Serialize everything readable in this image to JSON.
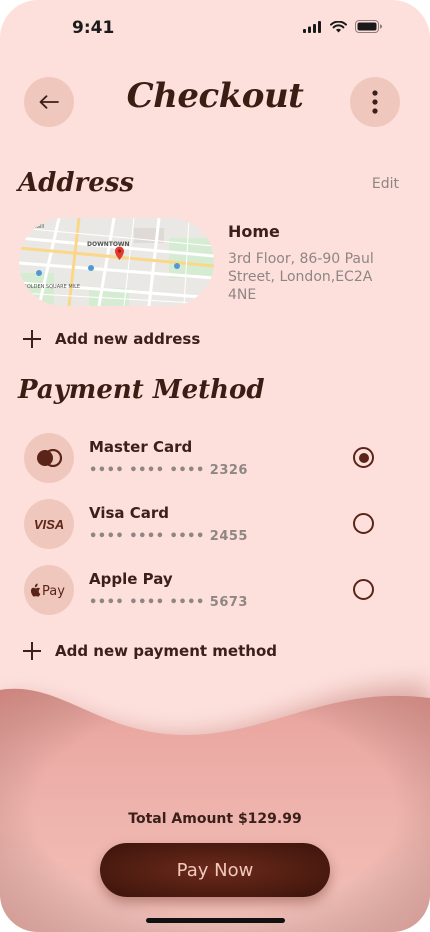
{
  "status_bar": {
    "time": "9:41"
  },
  "header": {
    "title": "Checkout"
  },
  "address": {
    "section_title": "Address",
    "edit_label": "Edit",
    "name": "Home",
    "detail": "3rd Floor, 86-90 Paul Street, London,EC2A 4NE",
    "add_label": "Add new address",
    "map_labels": [
      "DOWNTOWN",
      "GOLDEN SQUARE MILE",
      "McGill"
    ]
  },
  "payment": {
    "section_title": "Payment Method",
    "methods": [
      {
        "name": "Master Card",
        "number": "•••• •••• •••• 2326",
        "selected": true,
        "icon": "mastercard-icon"
      },
      {
        "name": "Visa Card",
        "number": "•••• •••• •••• 2455",
        "selected": false,
        "icon": "visa-icon"
      },
      {
        "name": "Apple Pay",
        "number": "•••• •••• •••• 5673",
        "selected": false,
        "icon": "apple-pay-icon"
      }
    ],
    "add_label": "Add new payment method"
  },
  "footer": {
    "total_label": "Total Amount $129.99",
    "pay_button": "Pay Now"
  },
  "colors": {
    "background": "#fde0dc",
    "accent_dark": "#5a2418",
    "chip": "#efc7bd",
    "sheet": "#eba9a2"
  }
}
